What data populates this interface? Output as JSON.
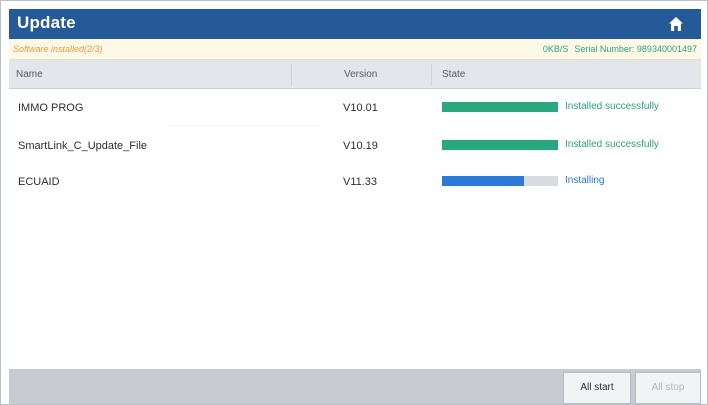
{
  "window": {
    "title": "Update",
    "home_icon": "home-icon"
  },
  "status": {
    "left_text": "Software installed(2/3)",
    "speed": "0KB/S",
    "serial_label": "Serial Number:",
    "serial_value": "989340001497",
    "left_color": "#f09a3a",
    "right_color": "#2aa57c"
  },
  "table": {
    "columns": {
      "name": "Name",
      "version": "Version",
      "state": "State"
    },
    "rows": [
      {
        "name": "IMMO PROG",
        "version": "V10.01",
        "state": "Installed successfully",
        "progress": 1.0,
        "bar_color": "#29a77f"
      },
      {
        "name": "SmartLink_C_Update_File",
        "version": "V10.19",
        "state": "Installed successfully",
        "progress": 1.0,
        "bar_color": "#29a77f"
      },
      {
        "name": "ECUAID",
        "version": "V11.33",
        "state": "Installing",
        "progress": 0.71,
        "bar_color": "#2d79d6"
      }
    ]
  },
  "footer": {
    "all_start": "All start",
    "all_stop": "All stop"
  },
  "colors": {
    "titlebar": "#245a97",
    "installed_text": "#2aa57c",
    "installing_text": "#2d79d6"
  }
}
